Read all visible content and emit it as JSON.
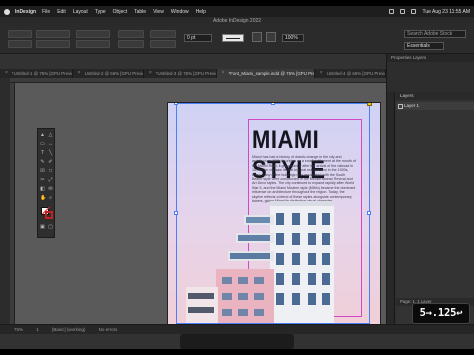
{
  "menubar": {
    "app": "InDesign",
    "items": [
      "File",
      "Edit",
      "Layout",
      "Type",
      "Object",
      "Table",
      "View",
      "Window",
      "Help"
    ],
    "clock": "Tue Aug 23 11:55 AM"
  },
  "window": {
    "title": "Adobe InDesign 2022"
  },
  "controlbar": {
    "zoom_value": "100%",
    "stroke_weight": "0 pt",
    "search_placeholder": "Search Adobe Stock",
    "workspace": "Essentials"
  },
  "tabs": [
    {
      "label": "*Untitled-1 @ 75% [GPU Preview]",
      "active": false
    },
    {
      "label": "Untitled-2 @ 66% [GPU Preview]",
      "active": false
    },
    {
      "label": "*Untitled-3 @ 75% [GPU Preview]",
      "active": false
    },
    {
      "label": "*Font_Miami_sample.indd @ 75% [GPU Preview]",
      "active": true
    },
    {
      "label": "Untitled-4 @ 66% [GPU Preview]",
      "active": false
    }
  ],
  "document": {
    "headline": "MIAMI STYLE",
    "body": "Miami has had a history of drastic change in the city and architecture. With its origins as a small settlement at the mouth of the Miami River, it grew quickly after the arrival of the railroad in 1896. The city saw its first big real estate boom in the 1920s, when many of the buildings now associated with the South Beach style were constructed in the Mediterranean Revival and Art Deco styles. The city continued to expand rapidly after World War II, and the Miami Modern style (MiMo) became the dominant influence on architecture throughout the region. Today, the skyline reflects a blend of these styles alongside contemporary towers, giving Miami its distinctive visual character."
  },
  "panels": {
    "tabs_label": "Properties  Layers",
    "layers_title": "Layers",
    "layer_name": "Layer 1",
    "footer": "Page: 1, 1 Layer"
  },
  "statusbar": {
    "zoom": "75%",
    "page": "1",
    "profile": "[Basic] (working)",
    "errors": "No errors"
  },
  "keyboard_overlay": "5→.125↩",
  "colors": {
    "accent_blue": "#4a7ff7",
    "guide_magenta": "#d04ac8",
    "page_gradient_top": "#cfd2f5",
    "page_gradient_bottom": "#f0cfd8",
    "building_pink": "#e9b3bf",
    "building_white": "#eef0f4"
  }
}
